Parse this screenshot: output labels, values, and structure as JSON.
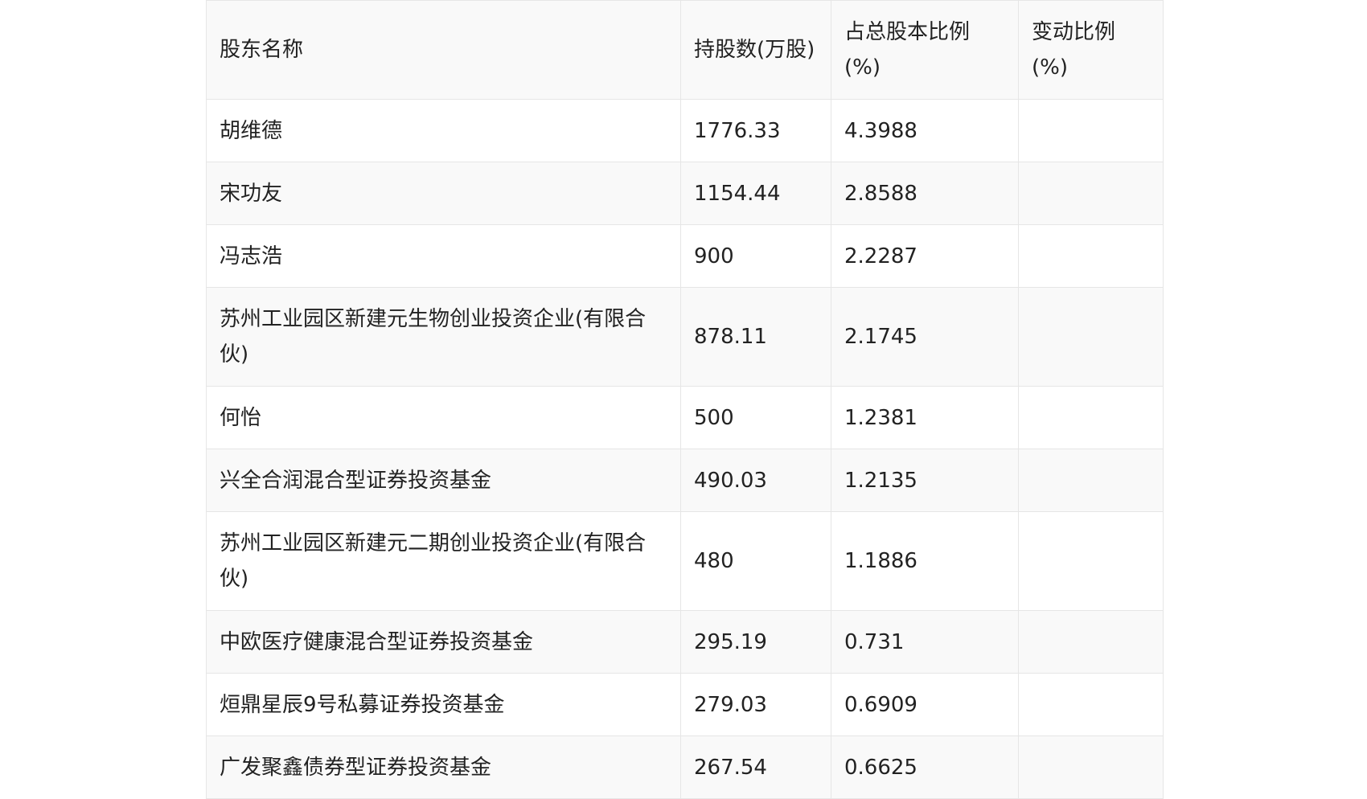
{
  "table": {
    "headers": [
      "股东名称",
      "持股数(万股)",
      "占总股本比例(%)",
      "变动比例(%)"
    ],
    "rows": [
      [
        "胡维德",
        "1776.33",
        "4.3988",
        ""
      ],
      [
        "宋功友",
        "1154.44",
        "2.8588",
        ""
      ],
      [
        "冯志浩",
        "900",
        "2.2287",
        ""
      ],
      [
        "苏州工业园区新建元生物创业投资企业(有限合伙)",
        "878.11",
        "2.1745",
        ""
      ],
      [
        "何怡",
        "500",
        "1.2381",
        ""
      ],
      [
        "兴全合润混合型证券投资基金",
        "490.03",
        "1.2135",
        ""
      ],
      [
        "苏州工业园区新建元二期创业投资企业(有限合伙)",
        "480",
        "1.1886",
        ""
      ],
      [
        "中欧医疗健康混合型证券投资基金",
        "295.19",
        "0.731",
        ""
      ],
      [
        "烜鼎星辰9号私募证券投资基金",
        "279.03",
        "0.6909",
        ""
      ],
      [
        "广发聚鑫债券型证券投资基金",
        "267.54",
        "0.6625",
        ""
      ]
    ]
  }
}
